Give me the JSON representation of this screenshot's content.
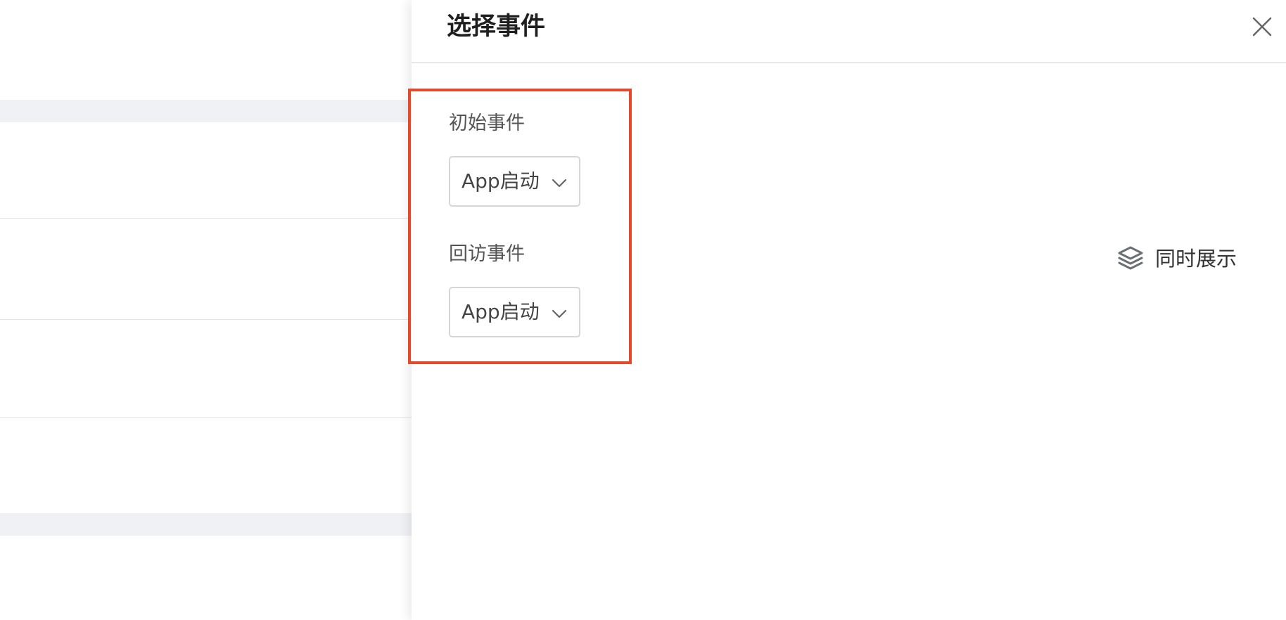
{
  "drawer": {
    "title": "选择事件",
    "close_icon": "close-icon"
  },
  "form": {
    "initial_event": {
      "label": "初始事件",
      "value": "App启动",
      "icon": "chevron-down-icon"
    },
    "return_event": {
      "label": "回访事件",
      "value": "App启动",
      "icon": "chevron-down-icon"
    }
  },
  "actions": {
    "simultaneous_display": {
      "label": "同时展示",
      "icon": "layers-icon"
    }
  },
  "colors": {
    "highlight_border": "#e34a2c",
    "background_band": "#f0f1f5",
    "divider": "#e8e8e8"
  }
}
